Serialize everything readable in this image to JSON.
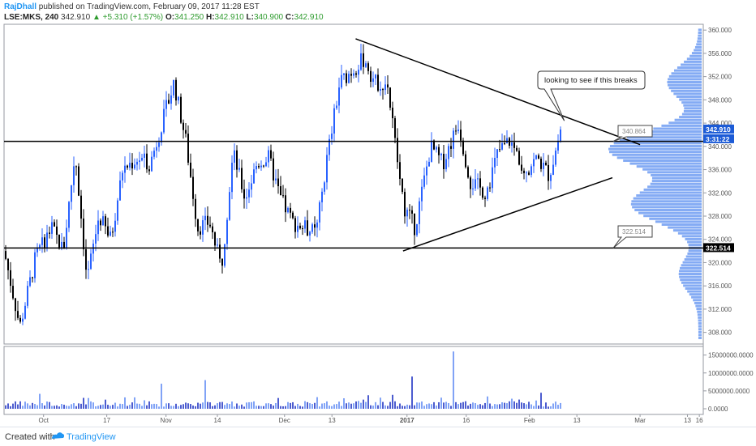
{
  "header": {
    "author": "RajDhall",
    "published": "published on TradingView.com, February 09, 2017 11:28 EST",
    "symbol": "LSE:MKS, 240",
    "last": "342.910",
    "change": "▲ +5.310 (+1.57%)",
    "open_label": "O:",
    "open": "341.250",
    "high_label": "H:",
    "high": "342.910",
    "low_label": "L:",
    "low": "340.900",
    "close_label": "C:",
    "close": "342.910"
  },
  "footer": {
    "created": "Created with",
    "brand": "TradingView"
  },
  "colors": {
    "up": "#2962ff",
    "down": "#000000",
    "accent": "#2196f3",
    "volume_profile": "#5b8ff0"
  },
  "chart_data": {
    "type": "candlestick",
    "price_axis": {
      "min": 306,
      "max": 361,
      "ticks": [
        "360.000",
        "356.000",
        "352.000",
        "348.000",
        "344.000",
        "340.000",
        "336.000",
        "332.000",
        "328.000",
        "324.000",
        "320.000",
        "316.000",
        "312.000",
        "308.000"
      ]
    },
    "volume_axis": {
      "ticks": [
        "15000000.0000",
        "10000000.0000",
        "5000000.0000",
        "0.0000"
      ]
    },
    "time_labels": [
      "Oct",
      "17",
      "Nov",
      "14",
      "Dec",
      "13",
      "2017",
      "16",
      "Feb",
      "13",
      "Mar",
      "13",
      "16"
    ],
    "price_labels": {
      "last_price": "342.910",
      "countdown": "3:31:22",
      "support_level": "322.514"
    },
    "callouts": [
      {
        "text": "looking to see if this breaks"
      },
      {
        "text": "340.864"
      },
      {
        "text": "322.514"
      }
    ],
    "horizontal_lines": [
      {
        "price": 340.864
      },
      {
        "price": 322.514
      }
    ],
    "trendlines": [
      {
        "from": {
          "date": "2016-12-19",
          "price": 358.5
        },
        "to": {
          "date": "2017-03-01",
          "price": 340.3
        }
      },
      {
        "from": {
          "date": "2016-12-31",
          "price": 322.0
        },
        "to": {
          "date": "2017-02-22",
          "price": 334.6
        }
      }
    ],
    "price_path": [
      [
        "2016-09-21",
        322
      ],
      [
        "2016-09-25",
        309
      ],
      [
        "2016-09-29",
        321
      ],
      [
        "2016-10-03",
        326
      ],
      [
        "2016-10-06",
        322
      ],
      [
        "2016-10-09",
        339
      ],
      [
        "2016-10-12",
        317
      ],
      [
        "2016-10-15",
        328
      ],
      [
        "2016-10-18",
        324
      ],
      [
        "2016-10-21",
        336
      ],
      [
        "2016-10-25",
        338
      ],
      [
        "2016-10-28",
        337
      ],
      [
        "2016-10-31",
        344
      ],
      [
        "2016-11-03",
        351
      ],
      [
        "2016-11-06",
        341
      ],
      [
        "2016-11-09",
        326
      ],
      [
        "2016-11-12",
        327
      ],
      [
        "2016-11-15",
        319
      ],
      [
        "2016-11-18",
        339
      ],
      [
        "2016-11-21",
        331
      ],
      [
        "2016-11-24",
        337
      ],
      [
        "2016-11-27",
        338
      ],
      [
        "2016-11-30",
        331
      ],
      [
        "2016-12-03",
        327
      ],
      [
        "2016-12-06",
        326
      ],
      [
        "2016-12-09",
        325
      ],
      [
        "2016-12-12",
        339
      ],
      [
        "2016-12-15",
        351
      ],
      [
        "2016-12-18",
        353
      ],
      [
        "2016-12-21",
        355
      ],
      [
        "2016-12-24",
        351
      ],
      [
        "2016-12-27",
        351
      ],
      [
        "2016-12-31",
        330
      ],
      [
        "2017-01-03",
        326
      ],
      [
        "2017-01-07",
        340
      ],
      [
        "2017-01-10",
        337
      ],
      [
        "2017-01-14",
        344
      ],
      [
        "2017-01-17",
        334
      ],
      [
        "2017-01-21",
        332
      ],
      [
        "2017-01-24",
        339
      ],
      [
        "2017-01-27",
        341
      ],
      [
        "2017-01-31",
        336
      ],
      [
        "2017-02-03",
        338
      ],
      [
        "2017-02-06",
        335
      ],
      [
        "2017-02-09",
        342.9
      ]
    ],
    "volume_spikes": [
      {
        "date": "2016-10-31",
        "value": 7000000
      },
      {
        "date": "2016-11-11",
        "value": 8000000
      },
      {
        "date": "2017-01-02",
        "value": 9000000
      },
      {
        "date": "2017-01-13",
        "value": 16000000
      }
    ]
  }
}
